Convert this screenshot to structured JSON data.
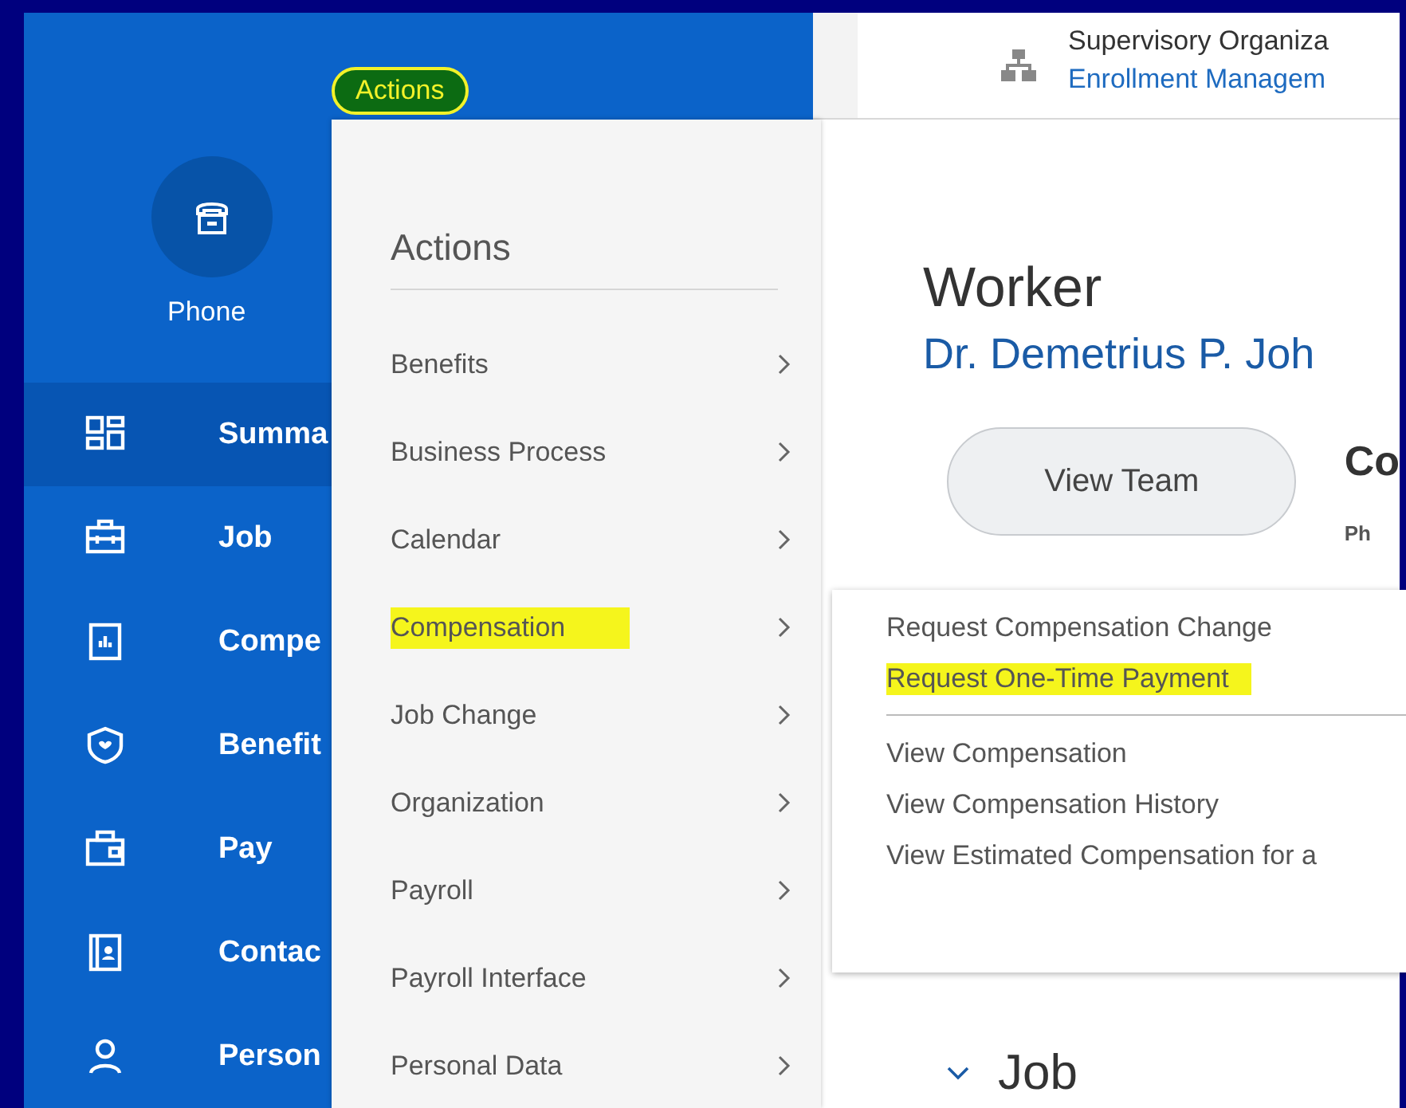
{
  "header": {
    "actions_button": {
      "label": "Actions",
      "highlighted": true
    },
    "contact": {
      "label": "Phone"
    }
  },
  "sidebar": {
    "items": [
      {
        "label": "Summa",
        "selected": true
      },
      {
        "label": "Job",
        "selected": false
      },
      {
        "label": "Compe",
        "selected": false
      },
      {
        "label": "Benefit",
        "selected": false
      },
      {
        "label": "Pay",
        "selected": false
      },
      {
        "label": "Contac",
        "selected": false
      },
      {
        "label": "Person",
        "selected": false
      }
    ]
  },
  "org_card": {
    "title": "Supervisory Organiza",
    "link": "Enrollment Managem"
  },
  "worker": {
    "heading": "Worker",
    "name": "Dr. Demetrius P. Joh",
    "button": "View Team",
    "contact_heading": "Co",
    "contact_label": "Ph"
  },
  "section": {
    "title": "Job",
    "expanded": true
  },
  "actions_menu": {
    "title": "Actions",
    "items": [
      {
        "label": "Benefits",
        "highlighted": false
      },
      {
        "label": "Business Process",
        "highlighted": false
      },
      {
        "label": "Calendar",
        "highlighted": false
      },
      {
        "label": "Compensation",
        "highlighted": true
      },
      {
        "label": "Job Change",
        "highlighted": false
      },
      {
        "label": "Organization",
        "highlighted": false
      },
      {
        "label": "Payroll",
        "highlighted": false
      },
      {
        "label": "Payroll Interface",
        "highlighted": false
      },
      {
        "label": "Personal Data",
        "highlighted": false
      }
    ]
  },
  "submenu": {
    "groups": [
      [
        {
          "label": "Request Compensation Change",
          "highlighted": false
        },
        {
          "label": "Request One-Time Payment",
          "highlighted": true
        }
      ],
      [
        {
          "label": "View Compensation",
          "highlighted": false
        },
        {
          "label": "View Compensation History",
          "highlighted": false
        },
        {
          "label": "View Estimated Compensation for a",
          "highlighted": false
        }
      ]
    ]
  }
}
